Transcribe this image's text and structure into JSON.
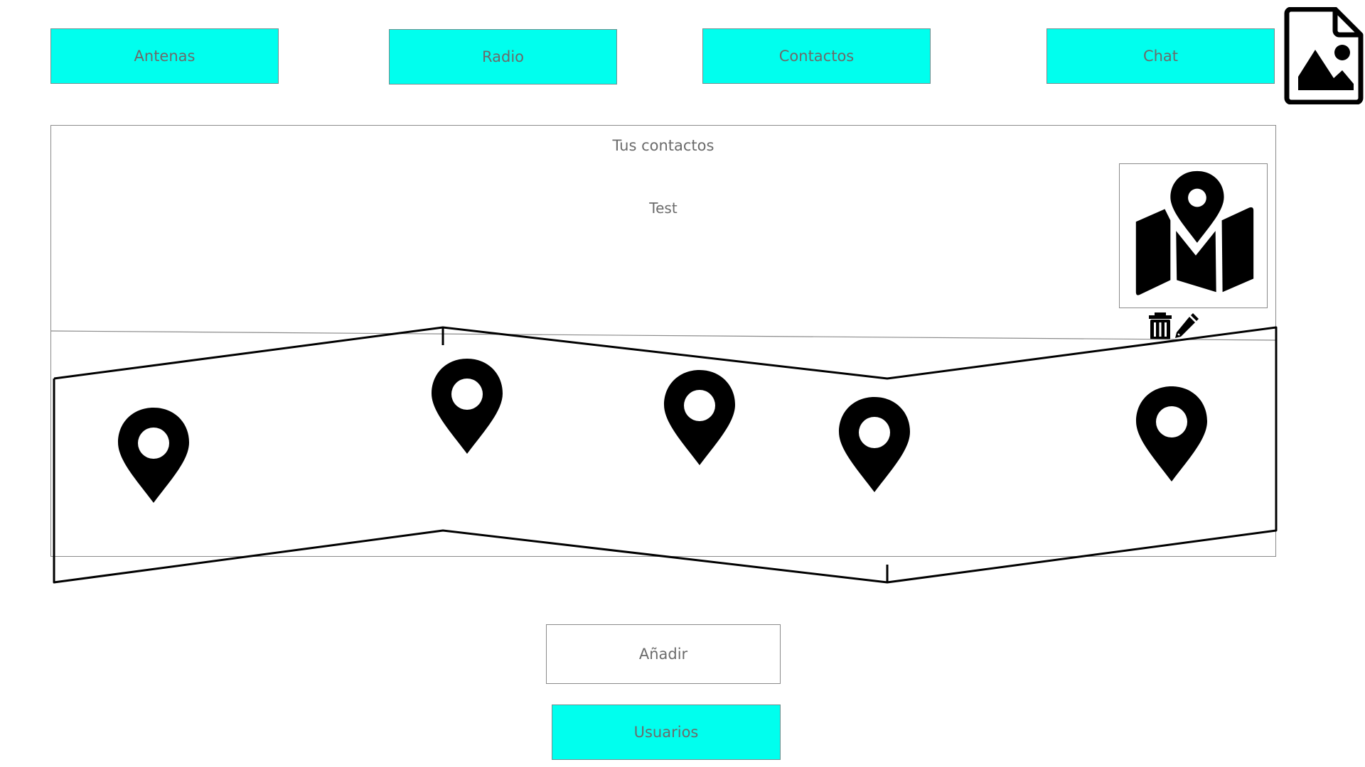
{
  "nav": {
    "antenas_label": "Antenas",
    "radio_label": "Radio",
    "contactos_label": "Contactos",
    "chat_label": "Chat"
  },
  "contacts": {
    "title": "Tus contactos",
    "items": [
      {
        "name": "Test",
        "thumbnail_icon": "map-location-icon",
        "actions": [
          "trash-icon",
          "pencil-icon"
        ]
      }
    ]
  },
  "map": {
    "icon": "folded-map-icon",
    "pins": [
      "map-pin-icon",
      "map-pin-icon",
      "map-pin-icon",
      "map-pin-icon",
      "map-pin-icon"
    ]
  },
  "footer": {
    "add_label": "Añadir",
    "users_label": "Usuarios"
  },
  "header_icon": "image-file-icon",
  "colors": {
    "accent": "#00ffee",
    "border": "#8a8a8a",
    "text": "#6b6b6b",
    "icon": "#000000"
  }
}
